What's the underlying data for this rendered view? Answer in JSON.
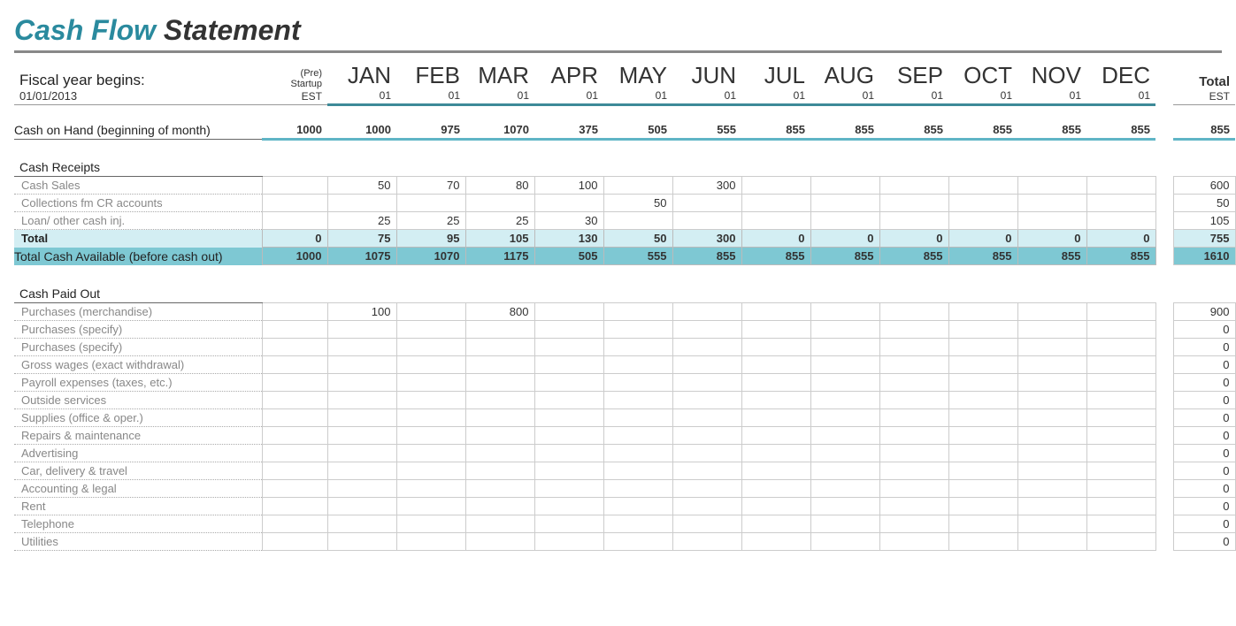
{
  "title_accent": "Cash Flow",
  "title_rest": " Statement",
  "fiscal_label": "Fiscal year begins:",
  "fiscal_date": "01/01/2013",
  "pre_header": "(Pre) Startup",
  "pre_sub": "EST",
  "months": [
    "JAN",
    "FEB",
    "MAR",
    "APR",
    "MAY",
    "JUN",
    "JUL",
    "AUG",
    "SEP",
    "OCT",
    "NOV",
    "DEC"
  ],
  "month_sub": "01",
  "total_header": "Total",
  "total_sub": "EST",
  "coh_label": "Cash on Hand (beginning of month)",
  "coh_values": [
    "1000",
    "1000",
    "975",
    "1070",
    "375",
    "505",
    "555",
    "855",
    "855",
    "855",
    "855",
    "855",
    "855"
  ],
  "coh_total": "855",
  "receipts_label": "Cash Receipts",
  "receipts_rows": [
    {
      "label": "Cash Sales",
      "v": [
        "",
        "50",
        "70",
        "80",
        "100",
        "",
        "300",
        "",
        "",
        "",
        "",
        "",
        ""
      ],
      "t": "600"
    },
    {
      "label": "Collections fm CR accounts",
      "v": [
        "",
        "",
        "",
        "",
        "",
        "50",
        "",
        "",
        "",
        "",
        "",
        "",
        ""
      ],
      "t": "50"
    },
    {
      "label": "Loan/ other cash inj.",
      "v": [
        "",
        "25",
        "25",
        "25",
        "30",
        "",
        "",
        "",
        "",
        "",
        "",
        "",
        ""
      ],
      "t": "105"
    }
  ],
  "receipts_total_label": "Total",
  "receipts_total_v": [
    "0",
    "75",
    "95",
    "105",
    "130",
    "50",
    "300",
    "0",
    "0",
    "0",
    "0",
    "0",
    "0"
  ],
  "receipts_total_t": "755",
  "tca_label": "Total Cash Available (before cash out)",
  "tca_v": [
    "1000",
    "1075",
    "1070",
    "1175",
    "505",
    "555",
    "855",
    "855",
    "855",
    "855",
    "855",
    "855",
    "855"
  ],
  "tca_t": "1610",
  "paidout_label": "Cash Paid Out",
  "paidout_rows": [
    {
      "label": "Purchases (merchandise)",
      "v": [
        "",
        "100",
        "",
        "800",
        "",
        "",
        "",
        "",
        "",
        "",
        "",
        "",
        ""
      ],
      "t": "900"
    },
    {
      "label": "Purchases (specify)",
      "v": [
        "",
        "",
        "",
        "",
        "",
        "",
        "",
        "",
        "",
        "",
        "",
        "",
        ""
      ],
      "t": "0"
    },
    {
      "label": "Purchases (specify)",
      "v": [
        "",
        "",
        "",
        "",
        "",
        "",
        "",
        "",
        "",
        "",
        "",
        "",
        ""
      ],
      "t": "0"
    },
    {
      "label": "Gross wages (exact withdrawal)",
      "v": [
        "",
        "",
        "",
        "",
        "",
        "",
        "",
        "",
        "",
        "",
        "",
        "",
        ""
      ],
      "t": "0"
    },
    {
      "label": "Payroll expenses (taxes, etc.)",
      "v": [
        "",
        "",
        "",
        "",
        "",
        "",
        "",
        "",
        "",
        "",
        "",
        "",
        ""
      ],
      "t": "0"
    },
    {
      "label": "Outside services",
      "v": [
        "",
        "",
        "",
        "",
        "",
        "",
        "",
        "",
        "",
        "",
        "",
        "",
        ""
      ],
      "t": "0"
    },
    {
      "label": "Supplies (office & oper.)",
      "v": [
        "",
        "",
        "",
        "",
        "",
        "",
        "",
        "",
        "",
        "",
        "",
        "",
        ""
      ],
      "t": "0"
    },
    {
      "label": "Repairs & maintenance",
      "v": [
        "",
        "",
        "",
        "",
        "",
        "",
        "",
        "",
        "",
        "",
        "",
        "",
        ""
      ],
      "t": "0"
    },
    {
      "label": "Advertising",
      "v": [
        "",
        "",
        "",
        "",
        "",
        "",
        "",
        "",
        "",
        "",
        "",
        "",
        ""
      ],
      "t": "0"
    },
    {
      "label": "Car, delivery & travel",
      "v": [
        "",
        "",
        "",
        "",
        "",
        "",
        "",
        "",
        "",
        "",
        "",
        "",
        ""
      ],
      "t": "0"
    },
    {
      "label": "Accounting & legal",
      "v": [
        "",
        "",
        "",
        "",
        "",
        "",
        "",
        "",
        "",
        "",
        "",
        "",
        ""
      ],
      "t": "0"
    },
    {
      "label": "Rent",
      "v": [
        "",
        "",
        "",
        "",
        "",
        "",
        "",
        "",
        "",
        "",
        "",
        "",
        ""
      ],
      "t": "0"
    },
    {
      "label": "Telephone",
      "v": [
        "",
        "",
        "",
        "",
        "",
        "",
        "",
        "",
        "",
        "",
        "",
        "",
        ""
      ],
      "t": "0"
    },
    {
      "label": "Utilities",
      "v": [
        "",
        "",
        "",
        "",
        "",
        "",
        "",
        "",
        "",
        "",
        "",
        "",
        ""
      ],
      "t": "0"
    }
  ]
}
